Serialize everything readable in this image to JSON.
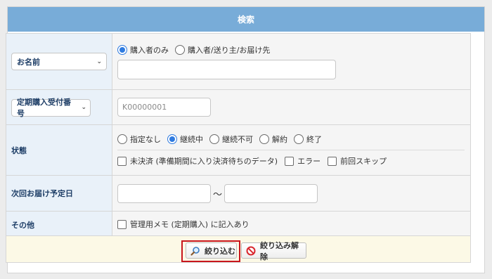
{
  "header": {
    "title": "検索"
  },
  "rows": {
    "name": {
      "select_label": "お名前",
      "radio_buyer_only": "購入者のみ",
      "radio_all": "購入者/送り主/お届け先",
      "input_value": ""
    },
    "subscription": {
      "select_label": "定期購入受付番号",
      "input_placeholder": "K00000001",
      "input_value": ""
    },
    "status": {
      "label": "状態",
      "radios": [
        "指定なし",
        "継続中",
        "継続不可",
        "解約",
        "終了"
      ],
      "selected": "継続中",
      "checks": [
        "未決済 (準備期間に入り決済待ちのデータ)",
        "エラー",
        "前回スキップ"
      ]
    },
    "next_delivery": {
      "label": "次回お届け予定日",
      "separator": "〜",
      "from_value": "",
      "to_value": ""
    },
    "other": {
      "label": "その他",
      "check_label": "管理用メモ (定期購入) に記入あり"
    }
  },
  "buttons": {
    "filter_label": "絞り込む",
    "filter_icon": "magnifier-icon",
    "clear_label": "絞り込み解除",
    "clear_icon": "no-entry-icon"
  },
  "colors": {
    "header_bg": "#78acd8",
    "label_bg": "#e9f1f9",
    "label_text": "#1d3d66",
    "button_row_bg": "#fcf9e6",
    "radio_selected": "#2f7be0",
    "highlight": "#c8161d"
  }
}
